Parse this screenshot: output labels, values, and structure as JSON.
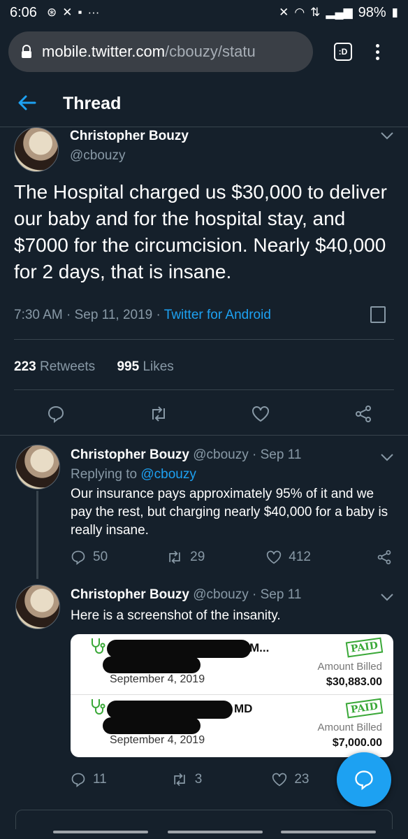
{
  "status_bar": {
    "time": "6:06",
    "left_icons": [
      "facebook-icon",
      "missed-call-icon",
      "message-icon",
      "more-dots-icon"
    ],
    "battery": "98%"
  },
  "browser": {
    "url_host": "mobile.twitter.com",
    "url_path": "/cbouzy/statu",
    "tabs_label": ":D"
  },
  "header": {
    "title": "Thread"
  },
  "main_tweet": {
    "name": "Christopher Bouzy",
    "handle": "@cbouzy",
    "text": "The Hospital charged us $30,000 to deliver our baby and for the hospital stay, and $7000 for the circumcision. Nearly $40,000 for 2 days, that is insane.",
    "timestamp": "7:30 AM · Sep 11, 2019 · ",
    "source": "Twitter for Android",
    "retweets_count": "223",
    "retweets_label": " Retweets",
    "likes_count": "995",
    "likes_label": " Likes"
  },
  "reply1": {
    "name": "Christopher Bouzy",
    "handle_date": " @cbouzy · Sep 11",
    "replying_prefix": "Replying to ",
    "replying_handle": "@cbouzy",
    "text": "Our insurance pays approximately 95% of it and we pay the rest, but charging nearly $40,000 for a baby is really insane.",
    "replies": "50",
    "retweets": "29",
    "likes": "412"
  },
  "reply2": {
    "name": "Christopher Bouzy",
    "handle_date": " @cbouzy · Sep 11",
    "text": "Here is a screenshot of the insanity.",
    "replies": "11",
    "retweets": "3",
    "likes": "23",
    "card": {
      "rows": [
        {
          "suffix": "M...",
          "date": "September 4, 2019",
          "stamp": "PAID",
          "billed_label": "Amount Billed",
          "amount": "$30,883.00"
        },
        {
          "suffix": "MD",
          "date": "September 4, 2019",
          "stamp": "PAID",
          "billed_label": "Amount Billed",
          "amount": "$7,000.00"
        }
      ]
    }
  },
  "colors": {
    "background": "#15202b",
    "accent": "#1da1f2",
    "muted": "#8899a6",
    "divider": "#38444d",
    "paid_green": "#3aa838"
  }
}
